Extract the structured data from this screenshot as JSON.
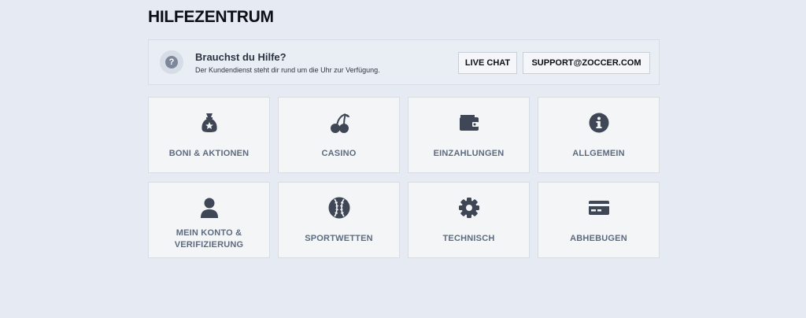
{
  "page": {
    "title": "HILFEZENTRUM"
  },
  "help": {
    "icon": "question-icon",
    "icon_glyph": "?",
    "title": "Brauchst du Hilfe?",
    "subtitle": "Der Kundendienst steht dir rund um die Uhr zur Verfügung.",
    "chat_label": "LIVE CHAT",
    "email_label": "SUPPORT@ZOCCER.COM"
  },
  "categories": [
    {
      "label": "BONI & AKTIONEN",
      "icon": "money-bag-icon"
    },
    {
      "label": "CASINO",
      "icon": "cherries-icon"
    },
    {
      "label": "EINZAHLUNGEN",
      "icon": "wallet-icon"
    },
    {
      "label": "ALLGEMEIN",
      "icon": "info-icon"
    },
    {
      "label": "MEIN KONTO & VERIFIZIERUNG",
      "icon": "user-icon"
    },
    {
      "label": "SPORTWETTEN",
      "icon": "baseball-icon"
    },
    {
      "label": "TECHNISCH",
      "icon": "gear-icon"
    },
    {
      "label": "ABHEBUGEN",
      "icon": "credit-card-icon"
    }
  ],
  "colors": {
    "background": "#e6ebf3",
    "tile": "#f4f5f7",
    "icon": "#3f4756",
    "label": "#5d6b80"
  }
}
